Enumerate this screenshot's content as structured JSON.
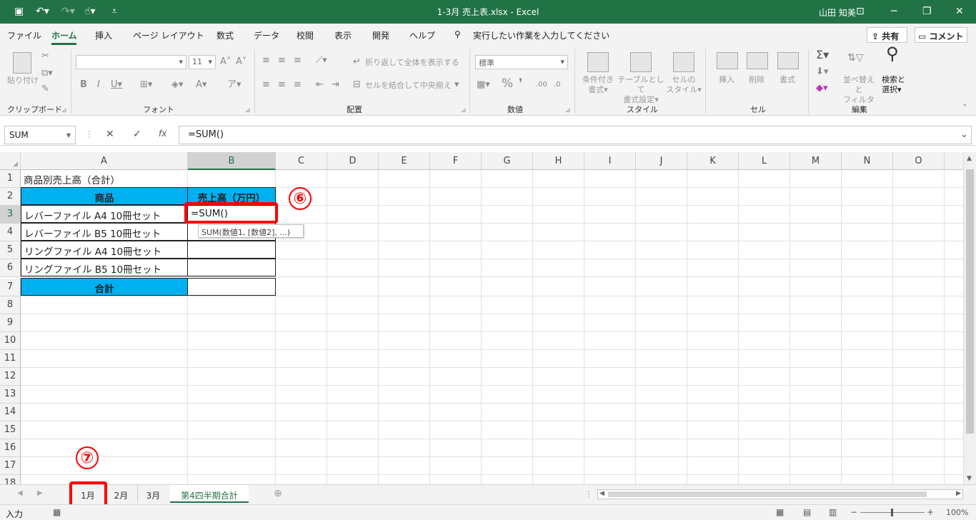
{
  "window": {
    "title": "1-3月 売上表.xlsx  -  Excel",
    "user": "山田 知美"
  },
  "menu": {
    "items": [
      "ファイル",
      "ホーム",
      "挿入",
      "ページ レイアウト",
      "数式",
      "データ",
      "校閲",
      "表示",
      "開発",
      "ヘルプ"
    ],
    "tell_me": "実行したい作業を入力してください",
    "share": "共有",
    "comment": "コメント"
  },
  "ribbon": {
    "groups": [
      "クリップボード",
      "フォント",
      "配置",
      "数値",
      "スタイル",
      "セル",
      "編集"
    ],
    "paste": "貼り付け",
    "font_size": "11",
    "wrap_text": "折り返して全体を表示する",
    "merge_center": "セルを結合して中央揃え",
    "number_format": "標準",
    "cond_format": [
      "条件付き",
      "書式"
    ],
    "table_format": [
      "テーブルとして",
      "書式設定"
    ],
    "cell_style": [
      "セルの",
      "スタイル"
    ],
    "insert": "挿入",
    "delete": "削除",
    "format": "書式",
    "sort_filter": [
      "並べ替えと",
      "フィルター"
    ],
    "find_select": [
      "検索と",
      "選択"
    ]
  },
  "formula_bar": {
    "name_box": "SUM",
    "formula": "=SUM()"
  },
  "columns": [
    "A",
    "B",
    "C",
    "D",
    "E",
    "F",
    "G",
    "H",
    "I",
    "J",
    "K",
    "L",
    "M",
    "N",
    "O"
  ],
  "rows": [
    "1",
    "2",
    "3",
    "4",
    "5",
    "6",
    "7",
    "8",
    "9",
    "10",
    "11",
    "12",
    "13",
    "14",
    "15",
    "16",
    "17",
    "18"
  ],
  "sheet": {
    "title": "商品別売上高（合計）",
    "header_product": "商品",
    "header_sales": "売上高（万円）",
    "products": [
      "レバーファイル A4 10冊セット",
      "レバーファイル B5 10冊セット",
      "リングファイル A4 10冊セット",
      "リングファイル B5 10冊セット"
    ],
    "total_label": "合計",
    "editing_value": "=SUM()",
    "tooltip": "SUM(数値1, [数値2], ...)"
  },
  "annotations": {
    "step6": "⑥",
    "step7": "⑦"
  },
  "tabs": [
    "1月",
    "2月",
    "3月",
    "第4四半期合計"
  ],
  "status": {
    "mode": "入力",
    "zoom": "100%"
  },
  "colors": {
    "excel_green": "#217346",
    "header_fill": "#00b0f0",
    "highlight": "#ff0000"
  }
}
